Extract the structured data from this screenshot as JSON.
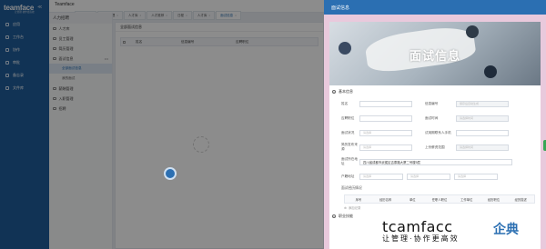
{
  "app": {
    "brand": "teamface",
    "brand_sub": "让管理·协作更高效",
    "header_title": "Teamface"
  },
  "nav": {
    "items": [
      {
        "label": "应用"
      },
      {
        "label": "工作台"
      },
      {
        "label": "协作"
      },
      {
        "label": "审批"
      },
      {
        "label": "备忘录"
      },
      {
        "label": "文件库"
      }
    ]
  },
  "tabs": [
    {
      "label": "工作台",
      "active": false
    },
    {
      "label": "客户管理",
      "active": false
    },
    {
      "label": "人才库",
      "active": false
    },
    {
      "label": "人才推荐",
      "active": false
    },
    {
      "label": "日程",
      "active": false
    },
    {
      "label": "人才库",
      "active": false
    },
    {
      "label": "面试信息",
      "active": true
    }
  ],
  "subnav": {
    "title": "人力招聘",
    "items": [
      {
        "label": "人才库"
      },
      {
        "label": "员工管理"
      },
      {
        "label": "简历管理"
      },
      {
        "label": "面试信息"
      }
    ],
    "children": [
      {
        "label": "全部面试信息",
        "active": true
      },
      {
        "label": "我的面试",
        "active": false
      }
    ],
    "items_after": [
      {
        "label": "薪酬管理"
      },
      {
        "label": "入职管理"
      },
      {
        "label": "招聘"
      }
    ]
  },
  "main": {
    "heading": "全部面试信息",
    "columns": [
      "姓名",
      "信息编号",
      "应聘职位"
    ]
  },
  "modal": {
    "title": "面试信息",
    "banner_title": "面试信息",
    "section_basic": "基本信息",
    "fields": {
      "name_label": "姓名",
      "info_no_label": "信息编号",
      "info_no_placeholder": "保存后自动生成",
      "position_label": "应聘职位",
      "interview_time_label": "面试时间",
      "interview_time_placeholder": "请选择时间",
      "status_label": "面试状况",
      "status_placeholder": "请选择",
      "contact_phone_label": "试用期联系人手机",
      "resume_source_label": "简历发布来源",
      "resume_source_placeholder": "请选择",
      "last_salary_label": "上份薪资范围",
      "last_salary_placeholder": "请选择时间",
      "address_label": "面试所在地址",
      "address_value": "四川省成都市武侯区吉泰路大厦二号楼9层",
      "household_label": "户籍地址",
      "province_placeholder": "请选择",
      "city_placeholder": "请选择",
      "district_placeholder": "请选择"
    },
    "history_title": "面试经历情况",
    "history_columns": [
      "序号",
      "经历名称",
      "单位",
      "任职人职位",
      "工作单位",
      "经历职位",
      "经历描述"
    ],
    "add_label": "添加记录",
    "section_more": "职业技能"
  },
  "watermark": {
    "line1": "tcamfacc",
    "line2": "让管理·协作更高效",
    "logo_text": "企典"
  },
  "colors": {
    "primary": "#2b6fb2",
    "sidebar": "#1f5d9b",
    "modal_bg": "#e9c9dc"
  }
}
